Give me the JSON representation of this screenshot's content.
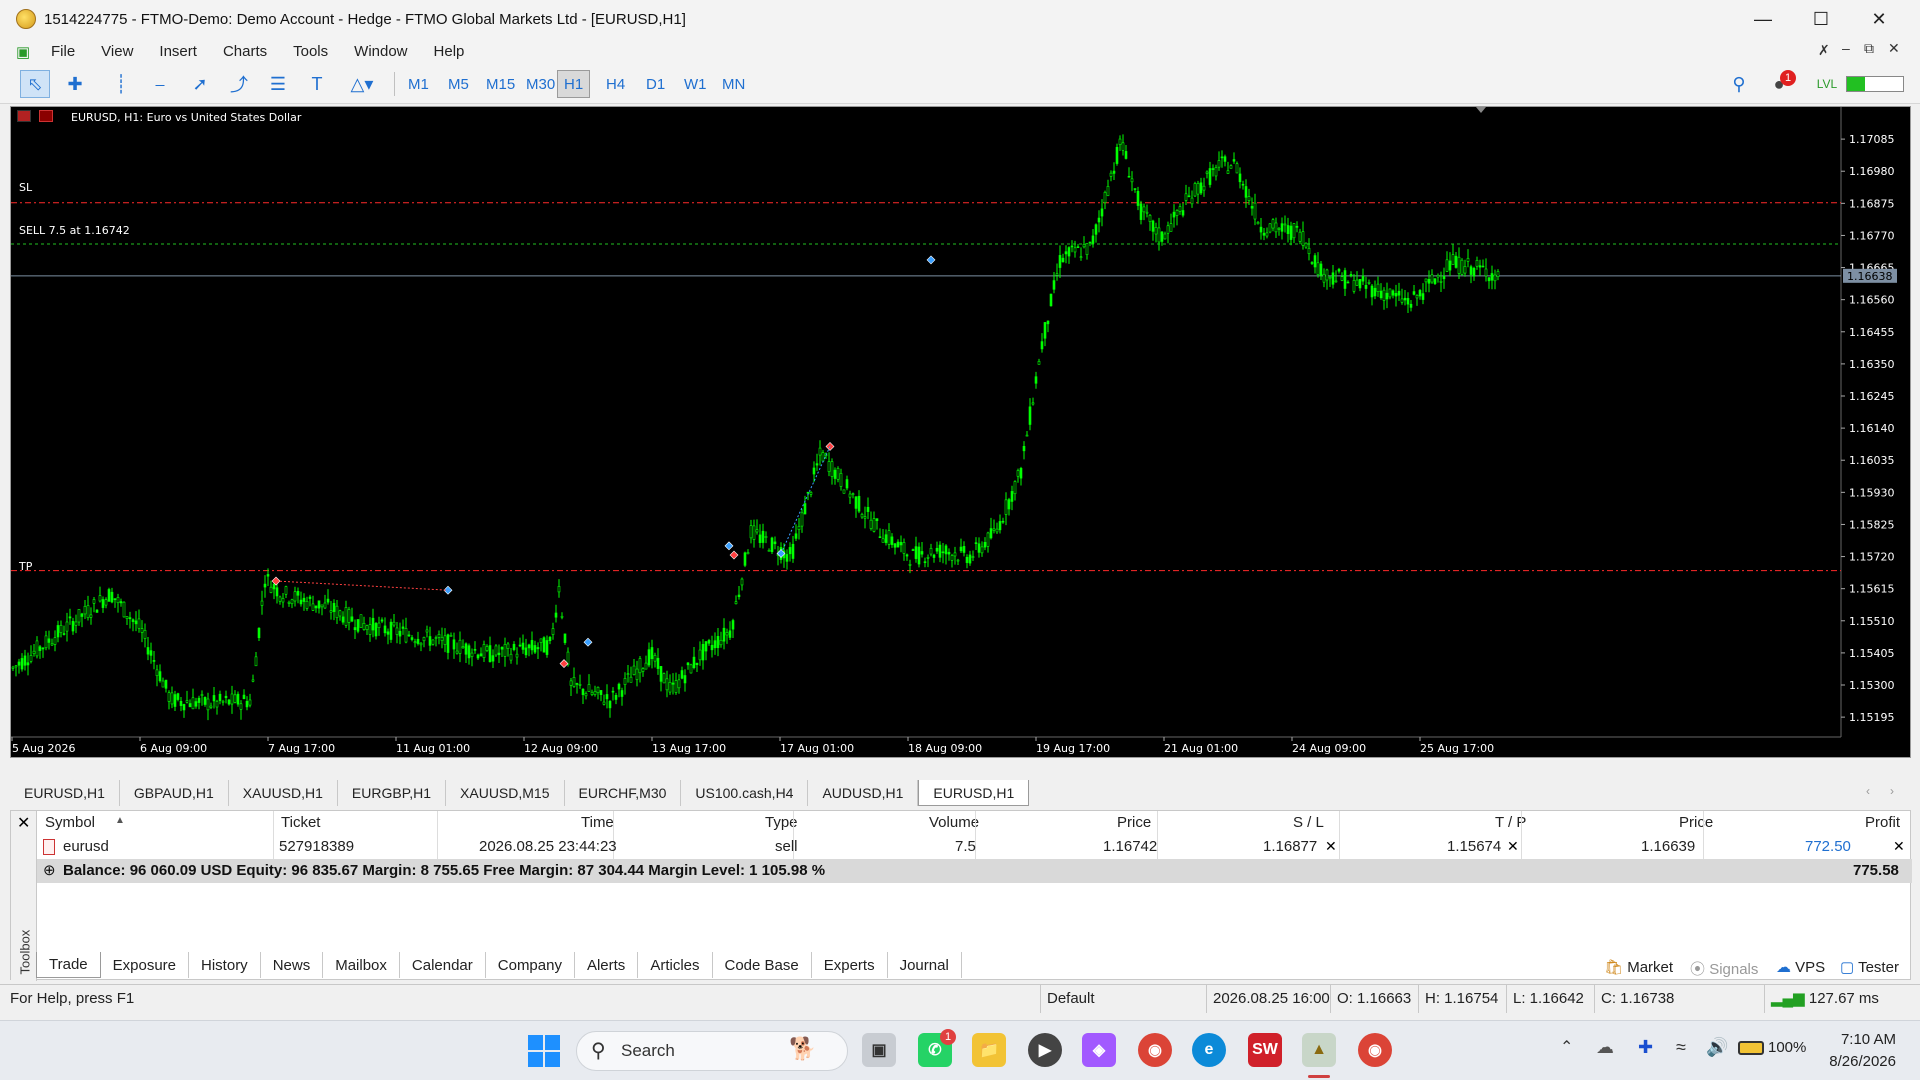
{
  "window": {
    "title": "1514224775 - FTMO-Demo: Demo Account - Hedge - FTMO Global Markets Ltd - [EURUSD,H1]"
  },
  "menu": [
    "File",
    "View",
    "Insert",
    "Charts",
    "Tools",
    "Window",
    "Help"
  ],
  "timeframes": [
    "M1",
    "M5",
    "M15",
    "M30",
    "H1",
    "H4",
    "D1",
    "W1",
    "MN"
  ],
  "selected_timeframe": "H1",
  "chart": {
    "header": "EURUSD, H1:  Euro vs United States Dollar",
    "sl_label": "SL",
    "tp_label": "TP",
    "order_label": "SELL 7.5 at 1.16742",
    "current_price_label": "1.16638",
    "price_ticks": [
      "1.17085",
      "1.16980",
      "1.16875",
      "1.16770",
      "1.16665",
      "1.16560",
      "1.16455",
      "1.16350",
      "1.16245",
      "1.16140",
      "1.16035",
      "1.15930",
      "1.15825",
      "1.15720",
      "1.15615",
      "1.15510",
      "1.15405",
      "1.15300",
      "1.15195"
    ],
    "time_ticks": [
      "5 Aug 2026",
      "6 Aug 09:00",
      "7 Aug 17:00",
      "11 Aug 01:00",
      "12 Aug 09:00",
      "13 Aug 17:00",
      "17 Aug 01:00",
      "18 Aug 09:00",
      "19 Aug 17:00",
      "21 Aug 01:00",
      "24 Aug 09:00",
      "25 Aug 17:00"
    ],
    "colors": {
      "bull": "#00ff00",
      "level": "#ff2a2a",
      "order": "#22c022",
      "current": "#7d8fa3"
    }
  },
  "symbol_tabs": [
    "EURUSD,H1",
    "GBPAUD,H1",
    "XAUUSD,H1",
    "EURGBP,H1",
    "XAUUSD,M15",
    "EURCHF,M30",
    "US100.cash,H4",
    "AUDUSD,H1",
    "EURUSD,H1"
  ],
  "trade_table": {
    "headers": [
      "Symbol",
      "Ticket",
      "Time",
      "Type",
      "Volume",
      "Price",
      "S / L",
      "T / P",
      "Price",
      "Profit"
    ],
    "row": {
      "symbol": "eurusd",
      "ticket": "527918389",
      "time": "2026.08.25 23:44:23",
      "type": "sell",
      "volume": "7.5",
      "price": "1.16742",
      "sl": "1.16877",
      "tp": "1.15674",
      "current_price": "1.16639",
      "profit": "772.50"
    },
    "balance_line": "Balance: 96 060.09 USD  Equity: 96 835.67  Margin: 8 755.65  Free Margin: 87 304.44  Margin Level: 1 105.98 %",
    "total_profit": "775.58"
  },
  "toolbox_label": "Toolbox",
  "bottom_tabs": [
    "Trade",
    "Exposure",
    "History",
    "News",
    "Mailbox",
    "Calendar",
    "Company",
    "Alerts",
    "Articles",
    "Code Base",
    "Experts",
    "Journal"
  ],
  "right_tools": [
    "Market",
    "Signals",
    "VPS",
    "Tester"
  ],
  "status": {
    "help": "For Help, press F1",
    "profile": "Default",
    "datetime": "2026.08.25 16:00",
    "open": "O: 1.16663",
    "high": "H: 1.16754",
    "low": "L: 1.16642",
    "close": "C: 1.16738",
    "ping": "127.67 ms"
  },
  "taskbar": {
    "search": "Search",
    "battery": "100%",
    "time": "7:10 AM",
    "date": "8/26/2026",
    "whatsapp_badge": "1"
  }
}
